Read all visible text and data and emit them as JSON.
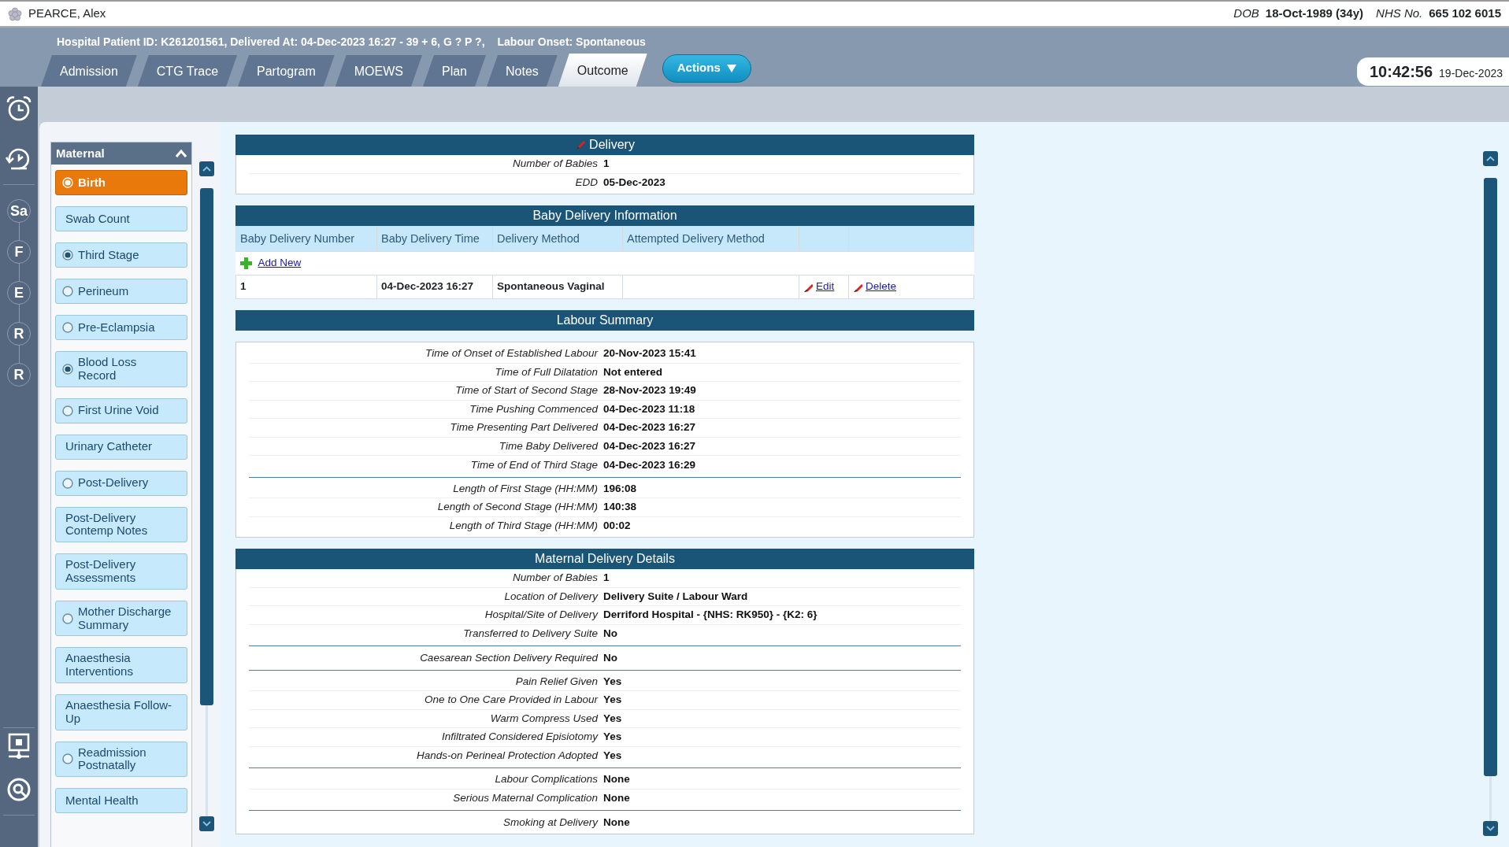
{
  "patient": {
    "name": "PEARCE, Alex",
    "dob_label": "DOB",
    "dob": "18-Oct-1989 (34y)",
    "nhs_label": "NHS No.",
    "nhs": "665 102 6015"
  },
  "banner": [
    "Hospital Patient ID: K261201561, Delivered At: 04-Dec-2023 16:27 - 39 + 6, G ? P ?,",
    "Labour Onset: Spontaneous"
  ],
  "tabs": [
    {
      "label": "Admission",
      "selected": false
    },
    {
      "label": "CTG Trace",
      "selected": false
    },
    {
      "label": "Partogram",
      "selected": false
    },
    {
      "label": "MOEWS",
      "selected": false
    },
    {
      "label": "Plan",
      "selected": false
    },
    {
      "label": "Notes",
      "selected": false
    },
    {
      "label": "Outcome",
      "selected": true
    }
  ],
  "actions_button": "Actions",
  "clock": {
    "time": "10:42:56",
    "date": "19-Dec-2023"
  },
  "rail": {
    "shortcuts": [
      "Sa",
      "F",
      "E",
      "R",
      "R"
    ]
  },
  "sidebar": {
    "title": "Maternal",
    "items": [
      {
        "label": "Birth",
        "kind": "radio",
        "checked": true,
        "selected": true
      },
      {
        "label": "Swab Count",
        "kind": "plain",
        "selected": false
      },
      {
        "label": "Third Stage",
        "kind": "radio",
        "checked": true,
        "selected": false
      },
      {
        "label": "Perineum",
        "kind": "radio",
        "checked": false,
        "selected": false
      },
      {
        "label": "Pre-Eclampsia",
        "kind": "radio",
        "checked": false,
        "selected": false
      },
      {
        "label": "Blood Loss Record",
        "kind": "radio",
        "checked": true,
        "selected": false
      },
      {
        "label": "First Urine Void",
        "kind": "radio",
        "checked": false,
        "selected": false
      },
      {
        "label": "Urinary Catheter",
        "kind": "plain",
        "selected": false
      },
      {
        "label": "Post-Delivery",
        "kind": "radio",
        "checked": false,
        "selected": false
      },
      {
        "label": "Post-Delivery Contemp Notes",
        "kind": "plain",
        "selected": false
      },
      {
        "label": "Post-Delivery Assessments",
        "kind": "plain",
        "selected": false
      },
      {
        "label": "Mother Discharge Summary",
        "kind": "radio",
        "checked": false,
        "selected": false
      },
      {
        "label": "Anaesthesia Interventions",
        "kind": "plain",
        "selected": false
      },
      {
        "label": "Anaesthesia Follow-Up",
        "kind": "plain",
        "selected": false
      },
      {
        "label": "Readmission Postnatally",
        "kind": "radio",
        "checked": false,
        "selected": false
      },
      {
        "label": "Mental Health",
        "kind": "plain",
        "selected": false
      }
    ]
  },
  "sections": [
    {
      "title": "Delivery",
      "kind": "fields",
      "editable": true,
      "detached": false,
      "groups": [
        [
          {
            "label": "Number of Babies",
            "value": "1"
          },
          {
            "label": "EDD",
            "value": "05-Dec-2023"
          }
        ]
      ]
    },
    {
      "title": "Baby Delivery Information",
      "kind": "table",
      "editable": false,
      "columns": [
        "Baby Delivery Number",
        "Baby Delivery Time",
        "Delivery Method",
        "Attempted Delivery Method",
        "",
        ""
      ],
      "add_new": "Add New",
      "rows": [
        {
          "cells": [
            "1",
            "04-Dec-2023 16:27",
            "Spontaneous Vaginal",
            ""
          ],
          "actions": [
            "Edit",
            "Delete"
          ]
        }
      ]
    },
    {
      "title": "Labour Summary",
      "kind": "fields",
      "editable": false,
      "detached": true,
      "groups": [
        [
          {
            "label": "Time of Onset of Established Labour",
            "value": "20-Nov-2023 15:41"
          },
          {
            "label": "Time of Full Dilatation",
            "value": "Not entered"
          },
          {
            "label": "Time of Start of Second Stage",
            "value": "28-Nov-2023 19:49"
          },
          {
            "label": "Time Pushing Commenced",
            "value": "04-Dec-2023 11:18"
          },
          {
            "label": "Time Presenting Part Delivered",
            "value": "04-Dec-2023 16:27"
          },
          {
            "label": "Time Baby Delivered",
            "value": "04-Dec-2023 16:27"
          },
          {
            "label": "Time of End of Third Stage",
            "value": "04-Dec-2023 16:29"
          }
        ],
        [
          {
            "label": "Length of First Stage (HH:MM)",
            "value": "196:08"
          },
          {
            "label": "Length of Second Stage (HH:MM)",
            "value": "140:38"
          },
          {
            "label": "Length of Third Stage (HH:MM)",
            "value": "00:02"
          }
        ]
      ]
    },
    {
      "title": "Maternal Delivery Details",
      "kind": "fields",
      "editable": false,
      "detached": false,
      "groups": [
        [
          {
            "label": "Number of Babies",
            "value": "1"
          },
          {
            "label": "Location of Delivery",
            "value": "Delivery Suite / Labour Ward"
          },
          {
            "label": "Hospital/Site of Delivery",
            "value": "Derriford Hospital - {NHS: RK950} - {K2: 6}"
          },
          {
            "label": "Transferred to Delivery Suite",
            "value": "No"
          }
        ],
        [
          {
            "label": "Caesarean Section Delivery Required",
            "value": "No"
          }
        ],
        [
          {
            "label": "Pain Relief Given",
            "value": "Yes"
          },
          {
            "label": "One to One Care Provided in Labour",
            "value": "Yes"
          },
          {
            "label": "Warm Compress Used",
            "value": "Yes"
          },
          {
            "label": "Infiltrated Considered Episiotomy",
            "value": "Yes"
          },
          {
            "label": "Hands-on Perineal Protection Adopted",
            "value": "Yes"
          }
        ],
        [
          {
            "label": "Labour Complications",
            "value": "None"
          },
          {
            "label": "Serious Maternal Complication",
            "value": "None"
          }
        ],
        [
          {
            "label": "Smoking at Delivery",
            "value": "None"
          }
        ]
      ]
    }
  ]
}
